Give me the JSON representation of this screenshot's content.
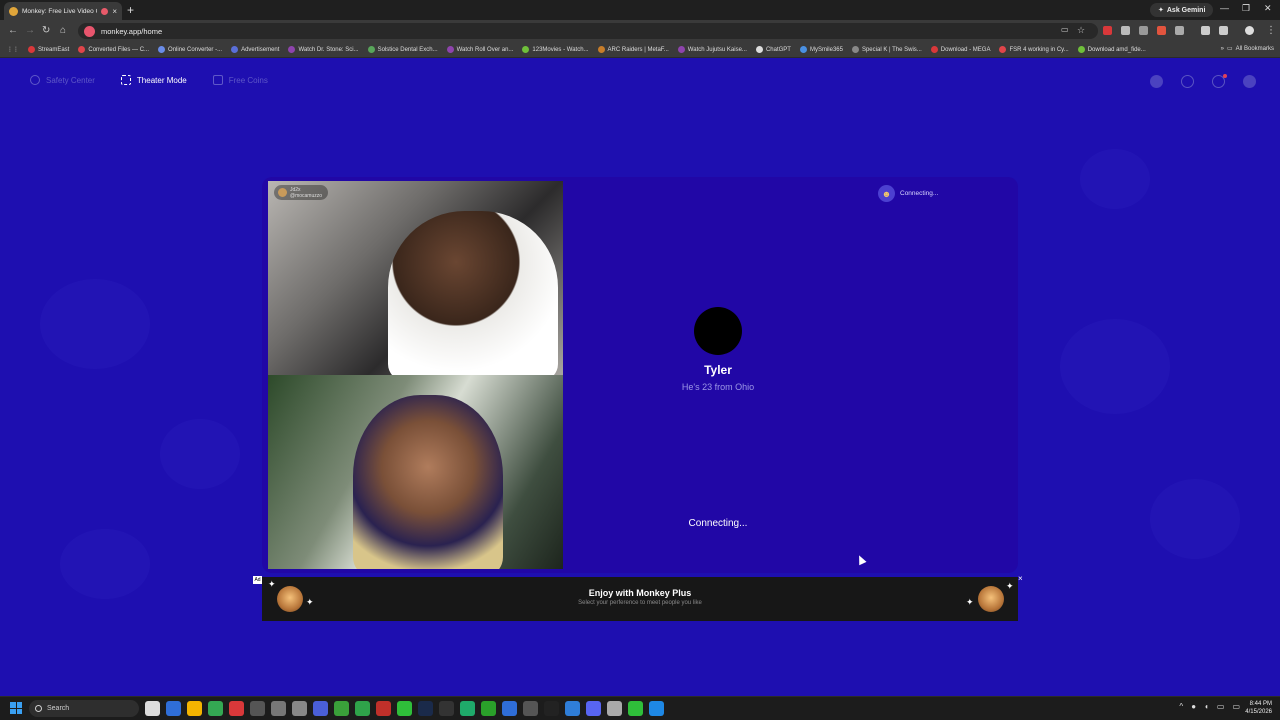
{
  "browser": {
    "tab_title": "Monkey: Free Live Video C...",
    "new_tab_symbol": "+",
    "ask_gemini": "Ask Gemini",
    "url": "monkey.app/home",
    "bookmarks": [
      {
        "label": "StreamEast",
        "color": "#d9383a"
      },
      {
        "label": "Converted Files — C...",
        "color": "#e0454a"
      },
      {
        "label": "Online Converter -...",
        "color": "#6a8ce8"
      },
      {
        "label": "Advertisement",
        "color": "#5a6fd8"
      },
      {
        "label": "Watch Dr. Stone: Sci...",
        "color": "#8e44ad"
      },
      {
        "label": "Solstice Dental Exch...",
        "color": "#58a55a"
      },
      {
        "label": "Watch Roll Over an...",
        "color": "#8e44ad"
      },
      {
        "label": "123Movies - Watch...",
        "color": "#6fbf3a"
      },
      {
        "label": "ARC Raiders | MetaF...",
        "color": "#c77d2a"
      },
      {
        "label": "Watch Jujutsu Kaise...",
        "color": "#8e44ad"
      },
      {
        "label": "ChatGPT",
        "color": "#dddddd"
      },
      {
        "label": "MySmile365",
        "color": "#4a90e2"
      },
      {
        "label": "Special K | The Swis...",
        "color": "#888888"
      },
      {
        "label": "Download - MEGA",
        "color": "#d9383a"
      },
      {
        "label": "FSR 4 working in Cy...",
        "color": "#e0454a"
      },
      {
        "label": "Download amd_fide...",
        "color": "#6fbf3a"
      }
    ],
    "all_bookmarks": "All Bookmarks"
  },
  "page": {
    "nav": {
      "safety_center": "Safety Center",
      "theater_mode": "Theater Mode",
      "free_coins": "Free Coins"
    },
    "video_caption": {
      "name": "Jd2x",
      "sub": "@mocamuzzo"
    },
    "status_top": "Connecting...",
    "profile": {
      "name": "Tyler",
      "info": "He's 23 from Ohio"
    },
    "status_main": "Connecting...",
    "ad": {
      "tag": "Ad",
      "headline": "Enjoy with Monkey Plus",
      "subline": "Select your perference to meet people you like",
      "close": "×"
    }
  },
  "taskbar": {
    "search_label": "Search",
    "time": "8:44 PM",
    "date": "4/15/2026"
  },
  "colors": {
    "page_bg": "#1e0fb0",
    "stage_bg": "#2107a6",
    "ad_bg": "#171717",
    "muted_text": "#9d98e6"
  }
}
